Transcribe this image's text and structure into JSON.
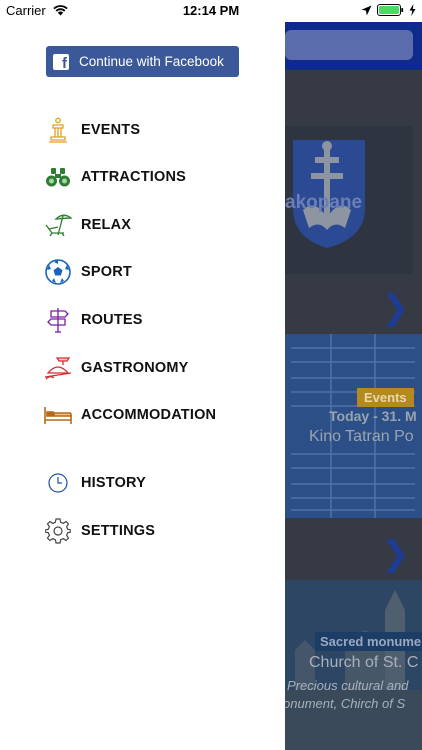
{
  "status_bar": {
    "carrier": "Carrier",
    "time": "12:14 PM"
  },
  "drawer": {
    "facebook_button": "Continue with Facebook",
    "menu": [
      {
        "label": "EVENTS",
        "icon": "pillar-icon"
      },
      {
        "label": "ATTRACTIONS",
        "icon": "binoculars-icon"
      },
      {
        "label": "RELAX",
        "icon": "beach-chair-icon"
      },
      {
        "label": "SPORT",
        "icon": "soccer-ball-icon"
      },
      {
        "label": "ROUTES",
        "icon": "signpost-icon"
      },
      {
        "label": "GASTRONOMY",
        "icon": "food-tray-icon"
      },
      {
        "label": "ACCOMMODATION",
        "icon": "bed-icon"
      },
      {
        "label": "HISTORY",
        "icon": "clock-icon"
      },
      {
        "label": "SETTINGS",
        "icon": "gear-icon"
      }
    ]
  },
  "background": {
    "crest_label": "akopane",
    "events_badge": "Events",
    "event_date": "Today - 31. M",
    "event_title": "Kino Tatran Po",
    "church_badge": "Sacred monume",
    "church_title": "Church of St. C",
    "church_desc_line1": "Precious cultural and",
    "church_desc_line2": "onument, Chirch of S"
  },
  "colors": {
    "facebook": "#3b5998",
    "events_icon": "#e0a020",
    "attractions_icon": "#2e7d32",
    "relax_icon": "#2e7d32",
    "sport_icon": "#1565c0",
    "routes_icon": "#7b1fa2",
    "gastronomy_icon": "#d32f2f",
    "accommodation_icon": "#b56a1a",
    "history_icon": "#1e4fa0",
    "settings_icon": "#444444"
  }
}
